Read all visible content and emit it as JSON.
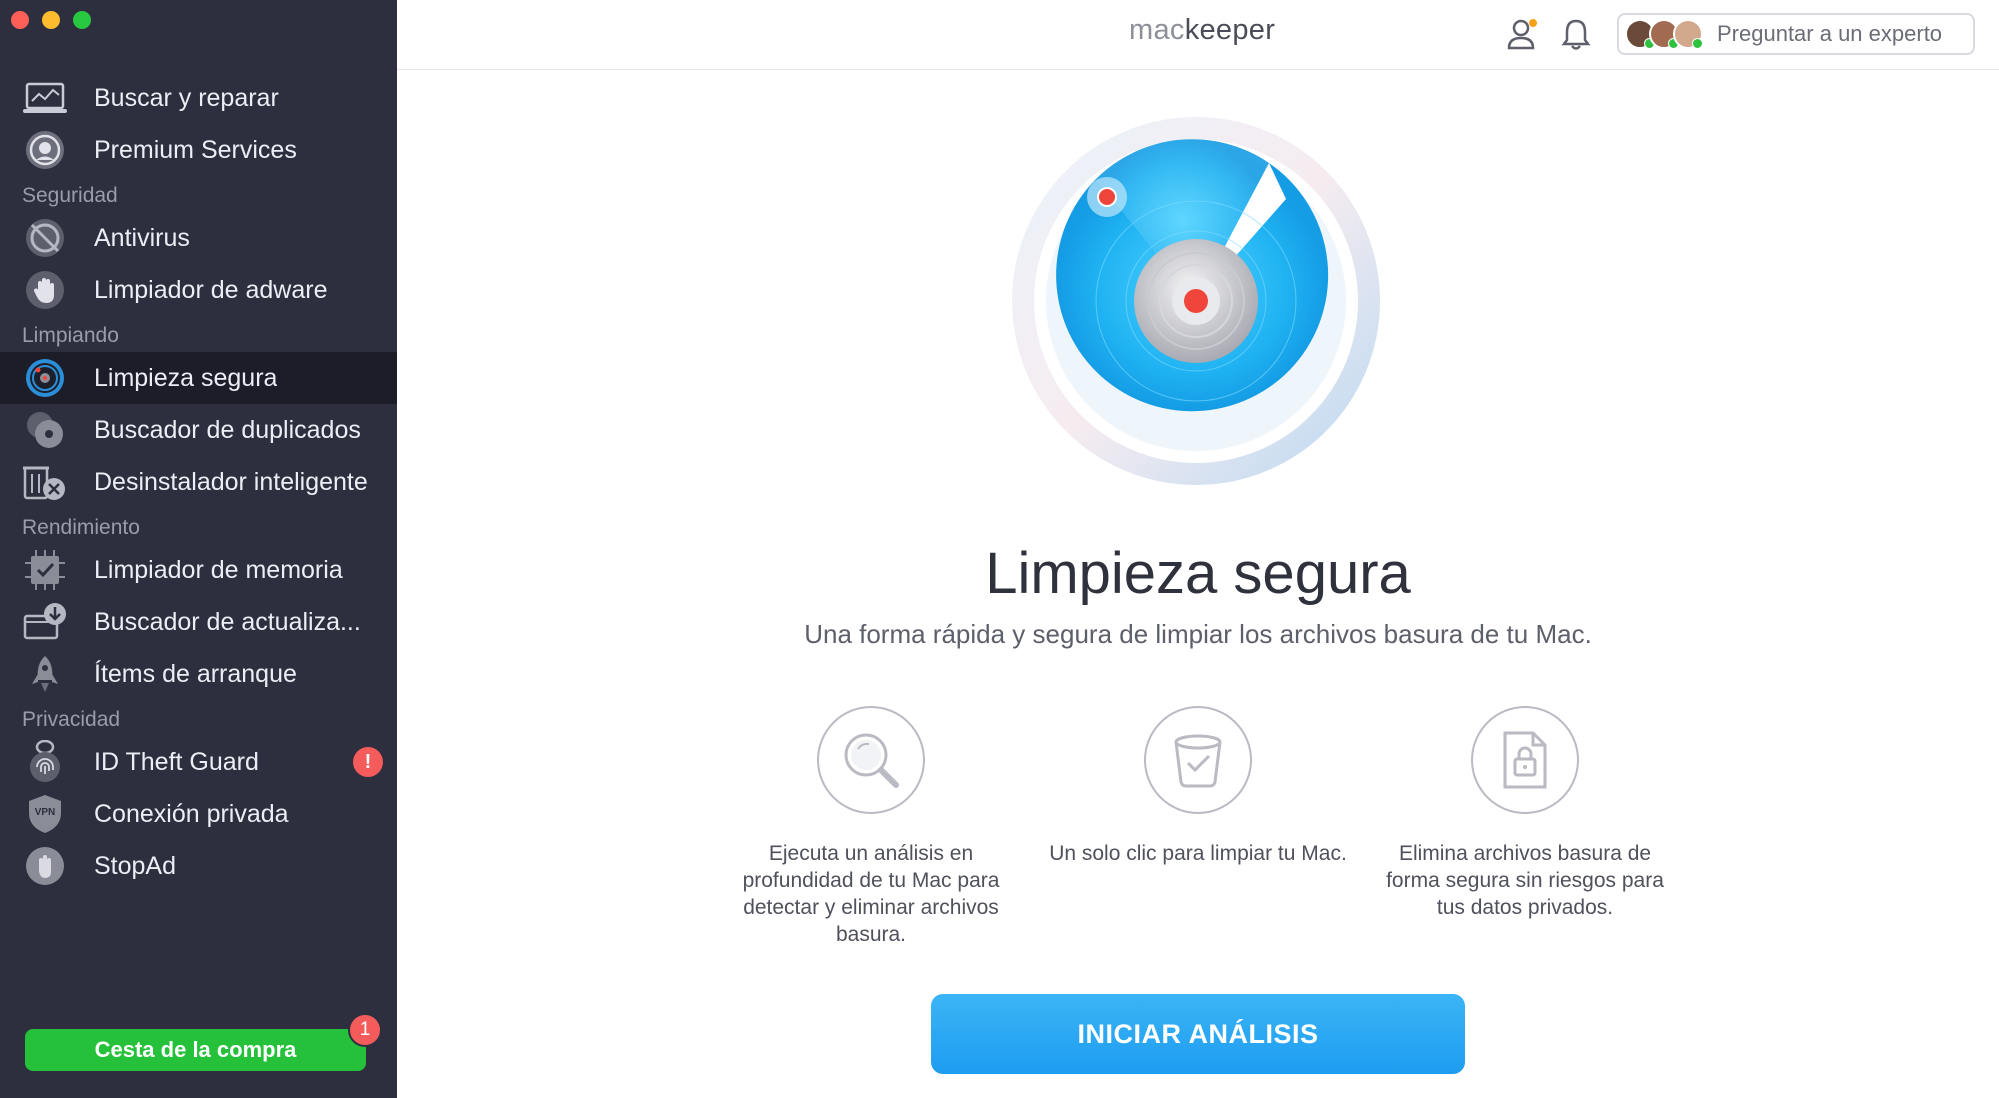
{
  "app": {
    "logo_prefix": "mac",
    "logo_suffix": "keeper"
  },
  "header": {
    "ask_expert_label": "Preguntar a un experto"
  },
  "sidebar": {
    "top_items": [
      {
        "label": "Buscar y reparar",
        "icon": "laptop-icon"
      },
      {
        "label": "Premium Services",
        "icon": "headset-icon"
      }
    ],
    "sections": [
      {
        "title": "Seguridad",
        "items": [
          {
            "label": "Antivirus",
            "icon": "antivirus-icon"
          },
          {
            "label": "Limpiador de adware",
            "icon": "hand-icon"
          }
        ]
      },
      {
        "title": "Limpiando",
        "items": [
          {
            "label": "Limpieza segura",
            "icon": "radar-icon",
            "active": true
          },
          {
            "label": "Buscador de duplicados",
            "icon": "duplicates-icon"
          },
          {
            "label": "Desinstalador inteligente",
            "icon": "uninstall-icon"
          }
        ]
      },
      {
        "title": "Rendimiento",
        "items": [
          {
            "label": "Limpiador de memoria",
            "icon": "memory-icon"
          },
          {
            "label": "Buscador de actualiza...",
            "icon": "update-icon"
          },
          {
            "label": "Ítems de arranque",
            "icon": "rocket-icon"
          }
        ]
      },
      {
        "title": "Privacidad",
        "items": [
          {
            "label": "ID Theft Guard",
            "icon": "fingerprint-icon",
            "badge": "!"
          },
          {
            "label": "Conexión privada",
            "icon": "vpn-icon"
          },
          {
            "label": "StopAd",
            "icon": "stopad-icon"
          }
        ]
      }
    ],
    "cart": {
      "label": "Cesta de la compra",
      "badge": "1"
    }
  },
  "main": {
    "title": "Limpieza segura",
    "subtitle": "Una forma rápida y segura de limpiar los archivos basura de tu Mac.",
    "features": [
      {
        "icon": "magnifier-icon",
        "text": "Ejecuta un análisis en profundidad de tu Mac para detectar y eliminar archivos basura."
      },
      {
        "icon": "trash-check-icon",
        "text": "Un solo clic para limpiar tu Mac."
      },
      {
        "icon": "secure-file-icon",
        "text": "Elimina archivos basura de forma segura sin riesgos para tus datos privados."
      }
    ],
    "cta_label": "INICIAR ANÁLISIS"
  },
  "colors": {
    "sidebar_bg": "#2d2f3e",
    "active_bg": "#1c1d28",
    "cart_green": "#25c13a",
    "cta_blue": "#1e9cf0",
    "alert_red": "#f45b5b"
  }
}
